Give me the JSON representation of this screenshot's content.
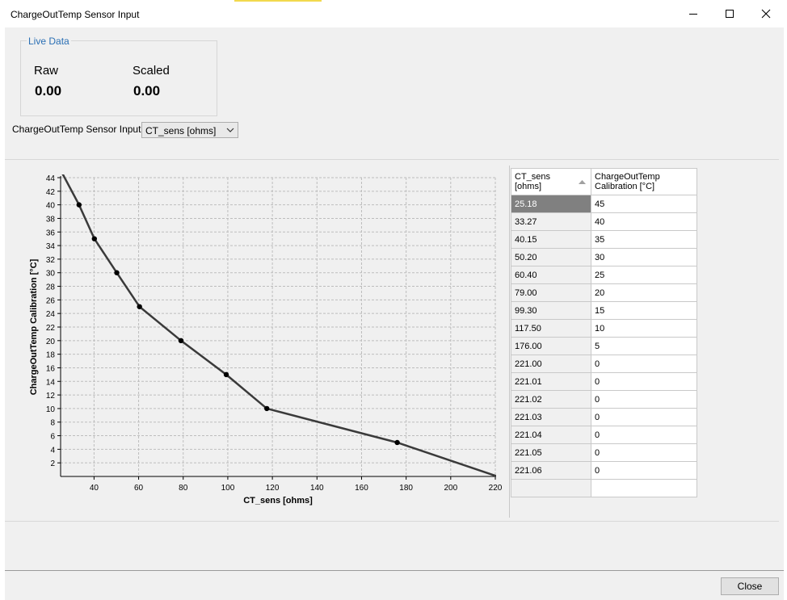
{
  "window": {
    "title": "ChargeOutTemp Sensor Input"
  },
  "live_data": {
    "title": "Live Data",
    "raw_label": "Raw",
    "raw_value": "0.00",
    "scaled_label": "Scaled",
    "scaled_value": "0.00"
  },
  "sensor_input": {
    "label": "ChargeOutTemp Sensor Input",
    "selected": "CT_sens [ohms]"
  },
  "table": {
    "headers": [
      [
        "CT_sens",
        "[ohms]"
      ],
      [
        "ChargeOutTemp",
        "Calibration [°C]"
      ]
    ],
    "rows": [
      [
        "25.18",
        "45"
      ],
      [
        "33.27",
        "40"
      ],
      [
        "40.15",
        "35"
      ],
      [
        "50.20",
        "30"
      ],
      [
        "60.40",
        "25"
      ],
      [
        "79.00",
        "20"
      ],
      [
        "99.30",
        "15"
      ],
      [
        "117.50",
        "10"
      ],
      [
        "176.00",
        "5"
      ],
      [
        "221.00",
        "0"
      ],
      [
        "221.01",
        "0"
      ],
      [
        "221.02",
        "0"
      ],
      [
        "221.03",
        "0"
      ],
      [
        "221.04",
        "0"
      ],
      [
        "221.05",
        "0"
      ],
      [
        "221.06",
        "0"
      ]
    ],
    "selected_row": 0
  },
  "chart_data": {
    "type": "line",
    "xlabel": "CT_sens [ohms]",
    "ylabel": "ChargeOutTemp Calibration [°C]",
    "xlim": [
      25,
      220
    ],
    "ylim": [
      0,
      44
    ],
    "xticks": [
      40,
      60,
      80,
      100,
      120,
      140,
      160,
      180,
      200,
      220
    ],
    "yticks": [
      2,
      4,
      6,
      8,
      10,
      12,
      14,
      16,
      18,
      20,
      22,
      24,
      26,
      28,
      30,
      32,
      34,
      36,
      38,
      40,
      42,
      44
    ],
    "grid": true,
    "series": [
      {
        "x": [
          25.18,
          33.27,
          40.15,
          50.2,
          60.4,
          79.0,
          99.3,
          117.5,
          176.0,
          221.0
        ],
        "y": [
          45,
          40,
          35,
          30,
          25,
          20,
          15,
          10,
          5,
          0
        ]
      }
    ],
    "color": "#3a3a3a"
  },
  "buttons": {
    "close": "Close"
  }
}
